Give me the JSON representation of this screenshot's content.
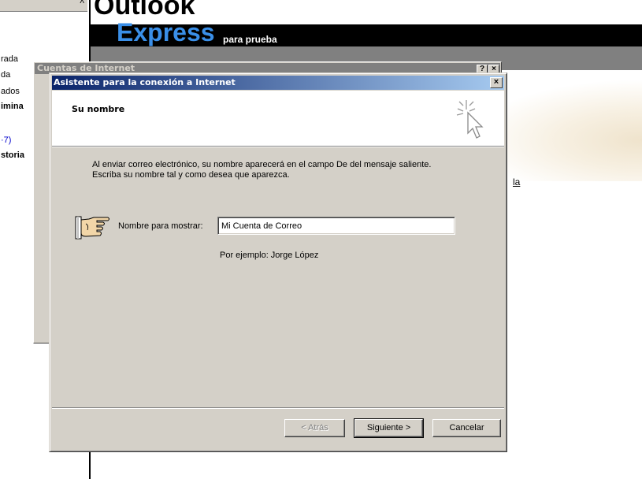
{
  "background": {
    "left_items": [
      {
        "text": "rada",
        "style": ""
      },
      {
        "text": "da",
        "style": ""
      },
      {
        "text": "ados",
        "style": ""
      },
      {
        "text": "imina",
        "style": "bold"
      },
      {
        "text": "·7)",
        "style": "blue"
      },
      {
        "text": "storia",
        "style": "bold"
      }
    ],
    "logo_top": "Outlook",
    "logo_bottom": "Express",
    "logo_sub": "para prueba",
    "link_fragment": "la",
    "scroll_glyph": "^"
  },
  "cuentas_dialog": {
    "title": "Cuentas de Internet",
    "help_glyph": "?",
    "close_glyph": "×"
  },
  "wizard": {
    "title": "Asistente para la conexión a Internet",
    "close_glyph": "×",
    "header_title": "Su nombre",
    "description": "Al enviar correo electrónico, su nombre aparecerá en el campo De del mensaje saliente. Escriba su nombre tal y como desea que aparezca.",
    "field_label": "Nombre para mostrar:",
    "field_value": "Mi Cuenta de Correo",
    "example": "Por ejemplo: Jorge López",
    "buttons": {
      "back": "< Atrás",
      "next": "Siguiente >",
      "cancel": "Cancelar"
    }
  },
  "colors": {
    "titlebar_start": "#0a246a",
    "titlebar_end": "#a6caf0",
    "dialog_face": "#d4d0c8",
    "express_blue": "#3a8fe8"
  }
}
